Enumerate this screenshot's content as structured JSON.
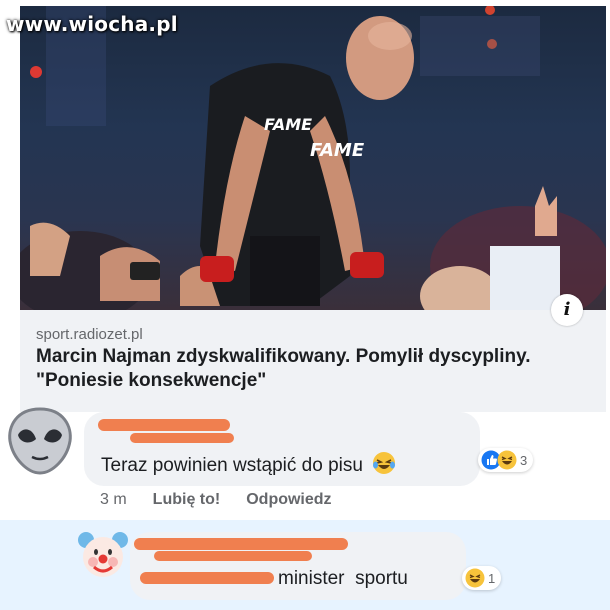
{
  "watermark": "www.wiocha.pl",
  "link_preview": {
    "source": "sport.radiozet.pl",
    "headline": "Marcin Najman zdyskwalifikowany. Pomylił dyscypliny. \"Poniesie konsekwencje\"",
    "info_icon_label": "i",
    "jersey_text": "FAME"
  },
  "comment": {
    "text": "Teraz powinien wstąpić do pisu",
    "emoji_icon": "laughing-crying-emoji",
    "reactions": {
      "icons": [
        "like-icon",
        "haha-icon"
      ],
      "count": "3"
    },
    "actions": {
      "time": "3 m",
      "like": "Lubię to!",
      "reply": "Odpowiedz"
    }
  },
  "reply": {
    "text": "minister  sportu",
    "reactions": {
      "icons": [
        "haha-icon"
      ],
      "count": "1"
    }
  },
  "colors": {
    "bubble": "#f0f2f5",
    "reply_highlight": "#e7f3ff",
    "redaction": "#f07f4f",
    "secondary_text": "#65676b",
    "like_blue": "#1877f2",
    "haha_yellow": "#f7c33b"
  }
}
